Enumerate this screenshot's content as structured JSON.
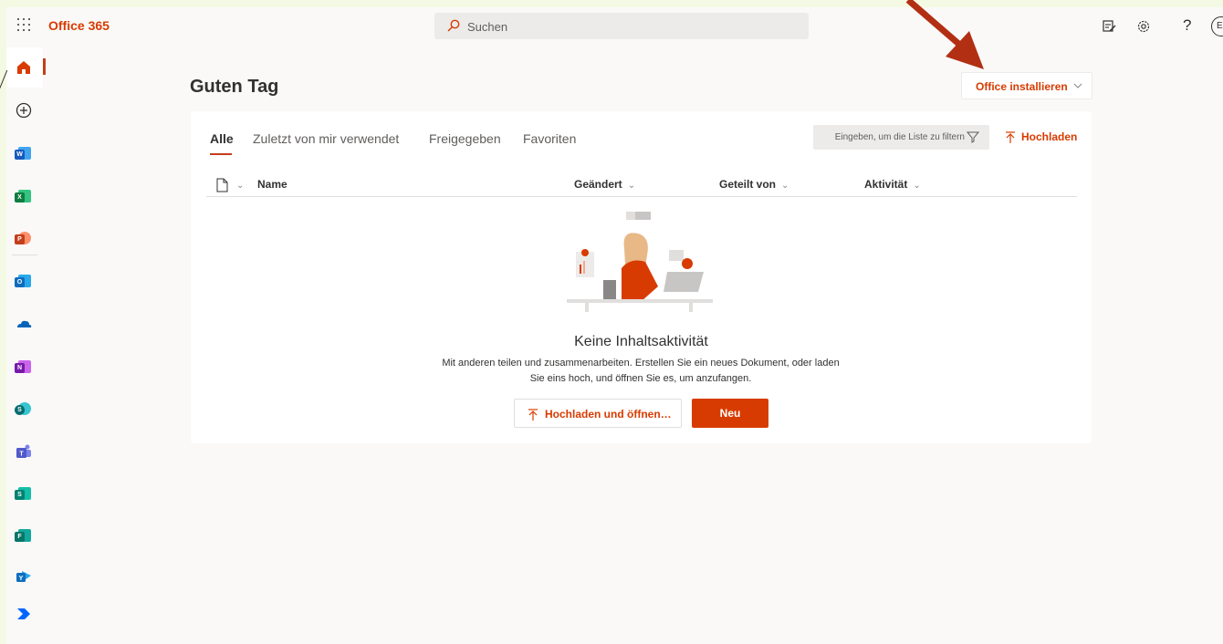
{
  "app": {
    "brand": "Office 365"
  },
  "search": {
    "placeholder": "Suchen"
  },
  "header": {
    "icons": [
      "feedback-icon",
      "gear-icon",
      "help-icon",
      "avatar"
    ],
    "help_glyph": "?",
    "avatar_initial": "E"
  },
  "rail": {
    "items": [
      {
        "name": "home",
        "icon": "home-icon"
      },
      {
        "name": "create",
        "icon": "plus-circle-icon"
      },
      {
        "name": "word",
        "icon": "word-icon",
        "letter": "W",
        "color": "#185abd"
      },
      {
        "name": "excel",
        "icon": "excel-icon",
        "letter": "X",
        "color": "#107c41"
      },
      {
        "name": "powerpoint",
        "icon": "powerpoint-icon",
        "letter": "P",
        "color": "#c43e1c"
      },
      {
        "name": "outlook",
        "icon": "outlook-icon",
        "letter": "O",
        "color": "#0f6cbd"
      },
      {
        "name": "onedrive",
        "icon": "onedrive-icon",
        "color": "#0364b8"
      },
      {
        "name": "onenote",
        "icon": "onenote-icon",
        "letter": "N",
        "color": "#7719aa"
      },
      {
        "name": "sharepoint",
        "icon": "sharepoint-icon",
        "letter": "S",
        "color": "#036c70"
      },
      {
        "name": "teams",
        "icon": "teams-icon",
        "color": "#5059c9"
      },
      {
        "name": "sway",
        "icon": "sway-icon",
        "letter": "S",
        "color": "#008272"
      },
      {
        "name": "forms",
        "icon": "forms-icon",
        "letter": "F",
        "color": "#077568"
      },
      {
        "name": "yammer",
        "icon": "yammer-icon",
        "letter": "Y",
        "color": "#106ebe"
      },
      {
        "name": "power-automate",
        "icon": "power-automate-icon",
        "color": "#0066ff"
      }
    ]
  },
  "main": {
    "greeting": "Guten Tag",
    "install_label": "Office installieren",
    "tabs": [
      {
        "label": "Alle",
        "active": true
      },
      {
        "label": "Zuletzt von mir verwendet",
        "active": false
      },
      {
        "label": "Freigegeben",
        "active": false
      },
      {
        "label": "Favoriten",
        "active": false
      }
    ],
    "filter_placeholder": "Eingeben, um die Liste zu filtern",
    "upload_label": "Hochladen",
    "columns": {
      "name": "Name",
      "changed": "Geändert",
      "shared_by": "Geteilt von",
      "activity": "Aktivität"
    },
    "empty": {
      "title": "Keine Inhaltsaktivität",
      "line1": "Mit anderen teilen und zusammenarbeiten. Erstellen Sie ein neues Dokument, oder laden",
      "line2": "Sie eins hoch, und öffnen Sie es, um anzufangen.",
      "upload_open_label": "Hochladen und öffnen…",
      "new_label": "Neu"
    }
  },
  "colors": {
    "accent": "#d83b01",
    "annotation_arrow": "#b22f14"
  }
}
